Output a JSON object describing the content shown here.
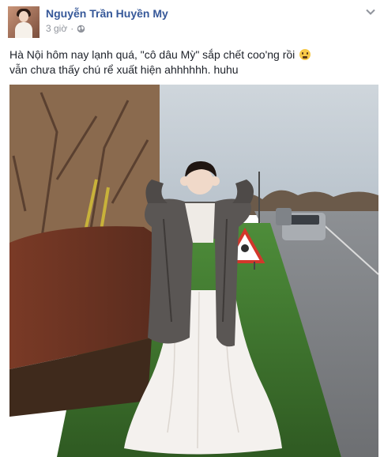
{
  "post": {
    "author_name": "Nguyễn Trần Huyền My",
    "time": "3 giờ",
    "separator": "·",
    "privacy_icon": "globe-icon",
    "options_icon": "chevron-down-icon",
    "text_line_1": "Hà Nội hôm nay lạnh quá, \"cô dâu Mỳ\" sắp chết coo'ng rồi",
    "text_line_2": "vẫn chưa thấy chú rể xuất hiện ahhhhhh. huhu",
    "emoji": "cold-face-emoji"
  },
  "colors": {
    "author_link": "#365899",
    "meta_text": "#90949c",
    "body_text": "#1d2129"
  }
}
